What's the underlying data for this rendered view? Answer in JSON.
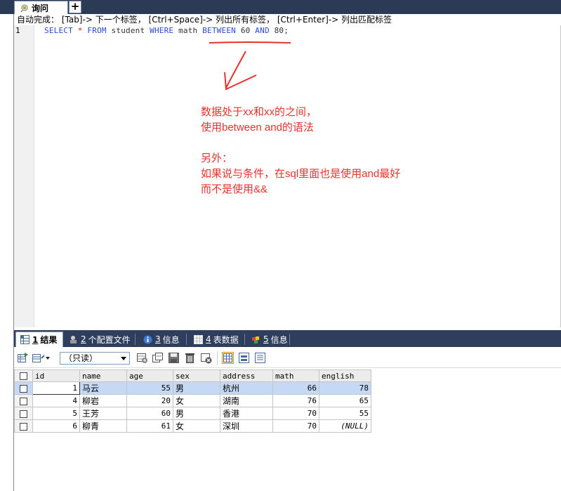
{
  "tabs": {
    "query_label": "询问",
    "add_label": "+"
  },
  "hint": "自动完成：  [Tab]-> 下一个标签，  [Ctrl+Space]-> 列出所有标签，  [Ctrl+Enter]-> 列出匹配标签",
  "editor": {
    "line_number": "1",
    "sql": {
      "select": "SELECT",
      "star": "*",
      "from": "FROM",
      "table": "student",
      "where": "WHERE",
      "column": "math",
      "between": "BETWEEN",
      "low": "60",
      "and": "AND",
      "high": "80;"
    }
  },
  "annotation": {
    "line1": "数据处于xx和xx的之间，",
    "line2": "使用between and的语法",
    "line3": "另外：",
    "line4": "如果说与条件，在sql里面也是使用and最好",
    "line5": "而不是使用&&"
  },
  "result_tabs": [
    {
      "num": "1",
      "label": "结果"
    },
    {
      "num": "2",
      "label": "个配置文件"
    },
    {
      "num": "3",
      "label": "信息"
    },
    {
      "num": "4",
      "label": "表数据"
    },
    {
      "num": "5",
      "label": "信息"
    }
  ],
  "toolbar": {
    "readonly_value": "（只读）"
  },
  "grid": {
    "columns": [
      "id",
      "name",
      "age",
      "sex",
      "address",
      "math",
      "english"
    ],
    "rows": [
      [
        "1",
        "马云",
        "55",
        "男",
        "杭州",
        "66",
        "78"
      ],
      [
        "4",
        "柳岩",
        "20",
        "女",
        "湖南",
        "76",
        "65"
      ],
      [
        "5",
        "王芳",
        "60",
        "男",
        "香港",
        "70",
        "55"
      ],
      [
        "6",
        "柳青",
        "61",
        "女",
        "深圳",
        "70",
        "(NULL)"
      ]
    ]
  },
  "colors": {
    "annotation": "#e8322b",
    "keyword": "#2a4bd7",
    "header_bar": "#2b3a55",
    "selected_row": "#c6d9f4"
  }
}
